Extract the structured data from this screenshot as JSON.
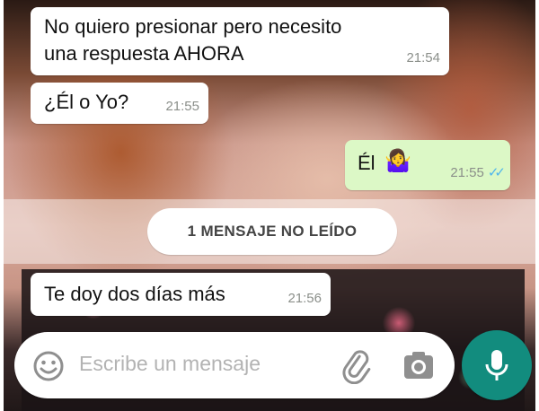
{
  "messages": [
    {
      "text_line1": "No quiero presionar pero necesito",
      "text_line2": "una respuesta AHORA",
      "time": "21:54",
      "direction": "in"
    },
    {
      "text": "¿Él o Yo?",
      "time": "21:55",
      "direction": "in"
    },
    {
      "text": "Él",
      "emoji": "🤷‍♀️",
      "time": "21:55",
      "direction": "out",
      "status": "read"
    },
    {
      "text": "Te doy dos días más",
      "time": "21:56",
      "direction": "in"
    }
  ],
  "unread_banner": "1 MENSAJE NO LEÍDO",
  "composer": {
    "placeholder": "Escribe un mensaje",
    "icons": [
      "emoji-icon",
      "attach-icon",
      "camera-icon"
    ]
  },
  "mic_button": {
    "icon": "mic-icon"
  },
  "colors": {
    "incoming_bubble": "#ffffff",
    "outgoing_bubble": "#dcf8c6",
    "accent": "#128c7e",
    "read_checks": "#4fb6ec",
    "timestamp": "#8b8f8a"
  }
}
